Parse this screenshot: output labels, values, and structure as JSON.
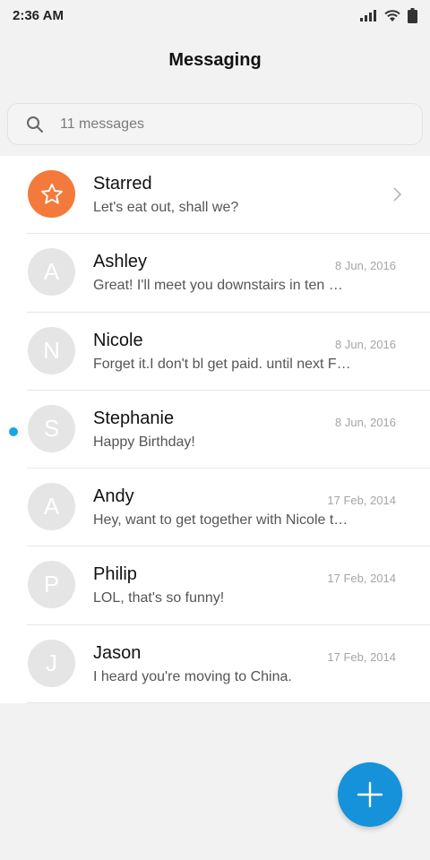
{
  "status_bar": {
    "time": "2:36 AM",
    "icons": [
      "signal-icon",
      "wifi-icon",
      "battery-icon"
    ]
  },
  "header": {
    "title": "Messaging"
  },
  "search": {
    "placeholder": "11 messages",
    "icon": "search-icon"
  },
  "colors": {
    "starred_avatar": "#f37a3a",
    "unread_dot": "#1aa5e6",
    "fab": "#1592d9",
    "avatar_default": "#e5e5e5"
  },
  "conversations": [
    {
      "name": "Starred",
      "preview": "Let's eat out, shall we?",
      "date": "",
      "avatar": "star-icon"
    },
    {
      "name": "Ashley",
      "preview": "Great! I'll meet you downstairs in ten minutes.",
      "date": "8 Jun, 2016",
      "avatar": "A"
    },
    {
      "name": "Nicole",
      "preview": "Forget it.I don't bl get paid. until next Friday.",
      "date": "8 Jun, 2016",
      "avatar": "N"
    },
    {
      "name": "Stephanie",
      "preview": "Happy Birthday!",
      "date": "8 Jun, 2016",
      "avatar": "S",
      "unread": true
    },
    {
      "name": "Andy",
      "preview": "Hey, want to get together with Nicole tonight?",
      "date": "17 Feb, 2014",
      "avatar": "A"
    },
    {
      "name": "Philip",
      "preview": "LOL, that's so funny!",
      "date": "17 Feb, 2014",
      "avatar": "P"
    },
    {
      "name": "Jason",
      "preview": "I heard you're moving to China.",
      "date": "17 Feb, 2014",
      "avatar": "J"
    }
  ],
  "fab": {
    "icon": "plus-icon"
  }
}
